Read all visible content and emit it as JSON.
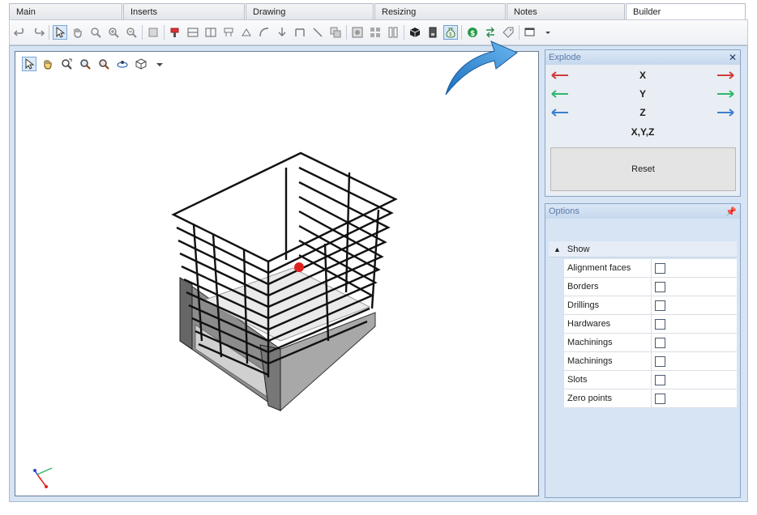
{
  "tabs": [
    {
      "label": "Main",
      "width": 140
    },
    {
      "label": "Inserts",
      "width": 150
    },
    {
      "label": "Drawing",
      "width": 158
    },
    {
      "label": "Resizing",
      "width": 162
    },
    {
      "label": "Notes",
      "width": 146
    },
    {
      "label": "Builder",
      "width": 148,
      "active": true
    }
  ],
  "explode": {
    "title": "Explode",
    "axes": [
      "X",
      "Y",
      "Z",
      "X,Y,Z"
    ],
    "axis_colors": {
      "X": "#d13b3b",
      "Y": "#2fb86a",
      "Z": "#3a7fd0"
    },
    "reset_label": "Reset"
  },
  "options": {
    "title": "Options",
    "group": "Show",
    "items": [
      {
        "label": "Alignment faces",
        "checked": false
      },
      {
        "label": "Borders",
        "checked": false
      },
      {
        "label": "Drillings",
        "checked": false
      },
      {
        "label": "Hardwares",
        "checked": false
      },
      {
        "label": "Machinings",
        "checked": false
      },
      {
        "label": "Machinings",
        "checked": false
      },
      {
        "label": "Slots",
        "checked": false
      },
      {
        "label": "Zero points",
        "checked": false
      }
    ]
  },
  "colors": {
    "accent": "#2f8ad8",
    "panel_bg": "#d6e4f4",
    "model_line": "#111111",
    "model_gray": "#7a7a7a",
    "marker": "#e02020"
  }
}
